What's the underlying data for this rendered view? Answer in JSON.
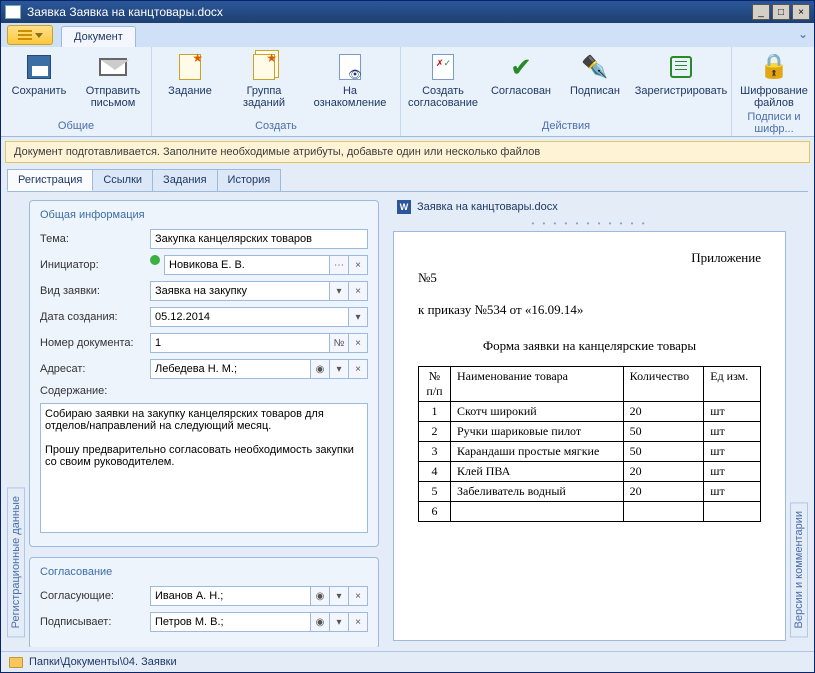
{
  "window": {
    "title": "Заявка Заявка на канцтовары.docx"
  },
  "ribbon": {
    "tab": "Документ",
    "groups": {
      "common": {
        "label": "Общие",
        "save": "Сохранить",
        "send": "Отправить письмом"
      },
      "create": {
        "label": "Создать",
        "task": "Задание",
        "task_group": "Группа заданий",
        "review": "На ознакомление"
      },
      "actions": {
        "label": "Действия",
        "create_approval": "Создать согласование",
        "approved": "Согласован",
        "signed": "Подписан",
        "register": "Зарегистрировать"
      },
      "sign": {
        "label": "Подписи и шифр...",
        "encrypt": "Шифрование файлов"
      }
    }
  },
  "status": "Документ подготавливается. Заполните необходимые атрибуты, добавьте один или несколько файлов",
  "tabs": [
    "Регистрация",
    "Ссылки",
    "Задания",
    "История"
  ],
  "side_left": "Регистрационные данные",
  "side_right": "Версии и комментарии",
  "general": {
    "title": "Общая информация",
    "subject_label": "Тема:",
    "subject": "Закупка канцелярских товаров",
    "initiator_label": "Инициатор:",
    "initiator": "Новикова Е. В.",
    "type_label": "Вид заявки:",
    "type": "Заявка на закупку",
    "date_label": "Дата создания:",
    "date": "05.12.2014",
    "number_label": "Номер документа:",
    "number": "1",
    "number_btn": "№",
    "addressee_label": "Адресат:",
    "addressee": "Лебедева Н. М.;",
    "content_label": "Содержание:",
    "content": "Собираю заявки на закупку канцелярских товаров для отделов/направлений на следующий месяц.\n\nПрошу предварительно согласовать необходимость закупки со своим руководителем."
  },
  "approval": {
    "title": "Согласование",
    "approvers_label": "Согласующие:",
    "approvers": "Иванов А. Н.;",
    "signer_label": "Подписывает:",
    "signer": "Петров М. В.;"
  },
  "file_name": "Заявка на канцтовары.docx",
  "preview": {
    "appendix": "Приложение",
    "no": "№5",
    "order": "к приказу №534    от  «16.09.14»",
    "form_title": "Форма заявки на канцелярские товары",
    "headers": [
      "№ п/п",
      "Наименование товара",
      "Количество",
      "Ед изм."
    ],
    "rows": [
      [
        "1",
        "Скотч широкий",
        "20",
        "шт"
      ],
      [
        "2",
        "Ручки шариковые пилот",
        "50",
        "шт"
      ],
      [
        "3",
        "Карандаши простые мягкие",
        "50",
        "шт"
      ],
      [
        "4",
        "Клей ПВА",
        "20",
        "шт"
      ],
      [
        "5",
        "Забеливатель водный",
        "20",
        "шт"
      ],
      [
        "6",
        "",
        "",
        ""
      ]
    ]
  },
  "footer": "Папки\\Документы\\04. Заявки"
}
